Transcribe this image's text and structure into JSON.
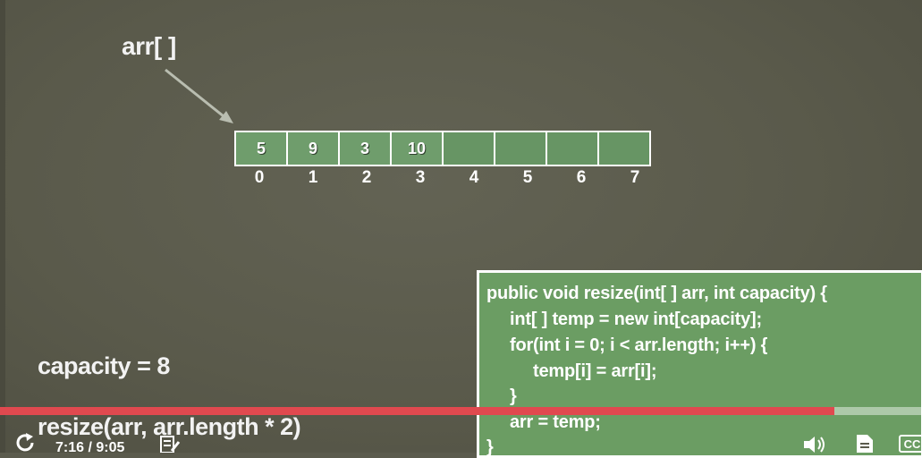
{
  "slide": {
    "array_label": "arr[ ]",
    "cells": [
      "5",
      "9",
      "3",
      "10",
      "",
      "",
      "",
      ""
    ],
    "indices": [
      "0",
      "1",
      "2",
      "3",
      "4",
      "5",
      "6",
      "7"
    ],
    "capacity_text": "capacity = 8",
    "resize_call_text": "resize(arr, arr.length * 2)",
    "code_lines": [
      "public void resize(int[ ] arr, int capacity) {",
      "int[ ] temp = new int[capacity];",
      "for(int i = 0; i < arr.length; i++) {",
      "temp[i] = arr[i];",
      "}",
      "arr = temp;",
      "}"
    ]
  },
  "player": {
    "current_time": "7:16",
    "duration": "9:05",
    "time_display": "7:16 / 9:05",
    "progress_fraction": 0.905,
    "progress_color": "#e0494f",
    "icons": [
      "replay-icon",
      "notes-icon",
      "volume-icon",
      "transcript-icon",
      "closed-captions-icon"
    ],
    "cc_label": "CC"
  },
  "colors": {
    "background": "#5b5b4d",
    "array_cell_fill": "#6f9d6c",
    "code_box_fill": "#6b9d63"
  }
}
